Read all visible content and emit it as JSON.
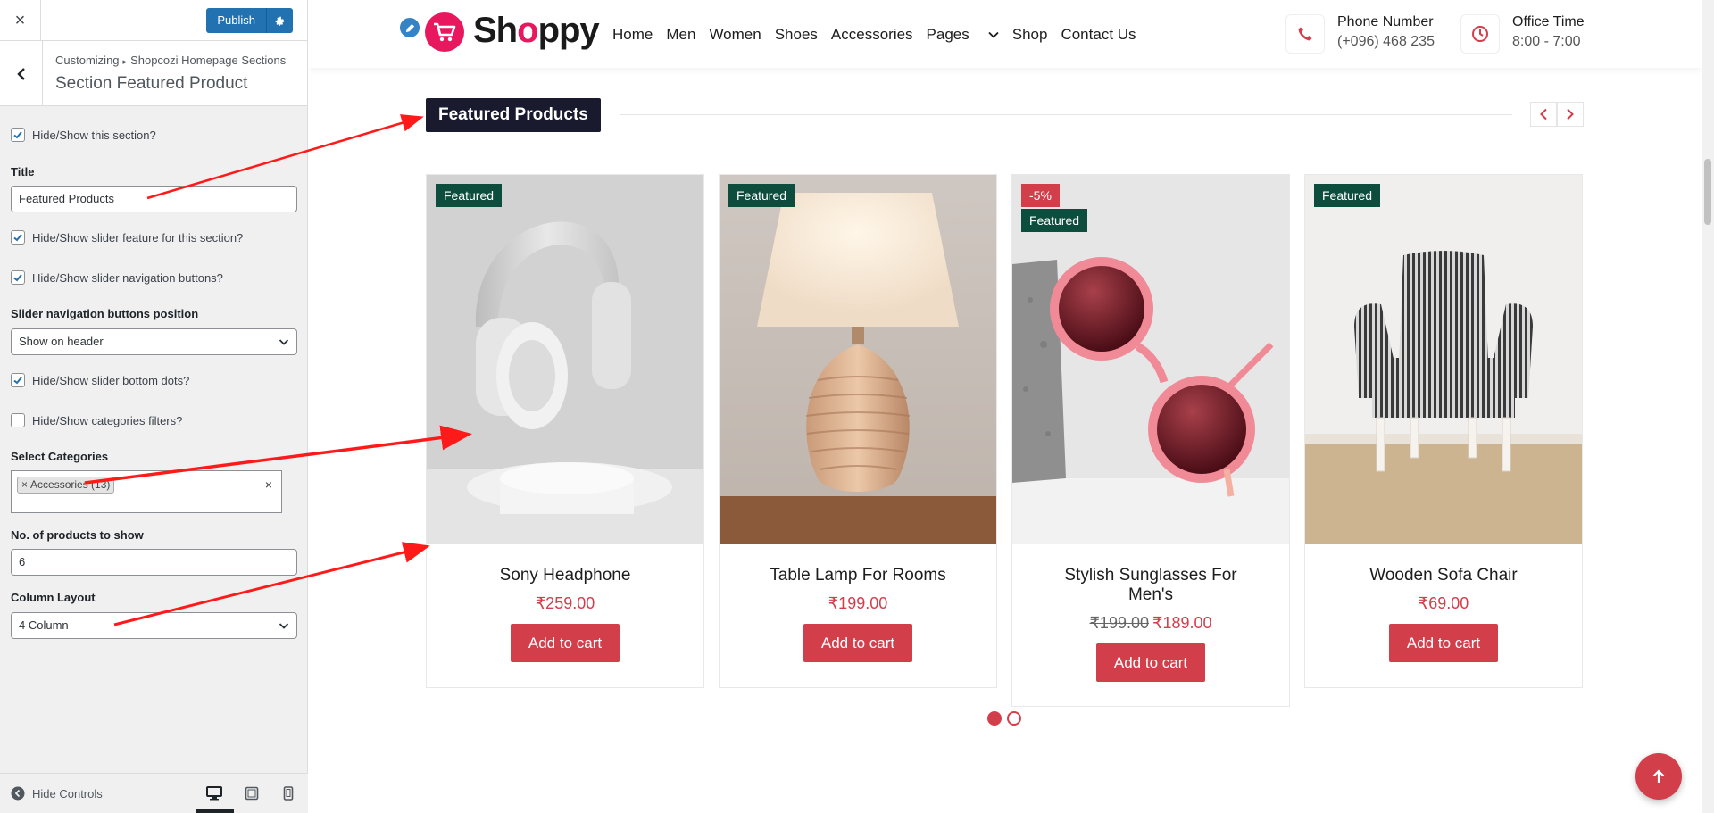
{
  "customizer": {
    "close_label": "×",
    "publish_label": "Publish",
    "breadcrumb": {
      "root": "Customizing",
      "sep": "▸",
      "parent": "Shopcozi Homepage Sections"
    },
    "section_title": "Section Featured Product",
    "controls": {
      "show_section": "Hide/Show this section?",
      "title_label": "Title",
      "title_value": "Featured Products",
      "slider_feature": "Hide/Show slider feature for this section?",
      "slider_nav": "Hide/Show slider navigation buttons?",
      "nav_position_label": "Slider navigation buttons position",
      "nav_position_value": "Show on header",
      "slider_dots": "Hide/Show slider bottom dots?",
      "cat_filters": "Hide/Show categories filters?",
      "select_categories_label": "Select Categories",
      "category_tag": "Accessories (13)",
      "category_tag_remove": "×",
      "category_clear": "×",
      "products_count_label": "No. of products to show",
      "products_count_value": "6",
      "column_layout_label": "Column Layout",
      "column_layout_value": "4 Column"
    },
    "footer": {
      "hide_controls": "Hide Controls"
    }
  },
  "site": {
    "logo_text": "Sh",
    "logo_o": "o",
    "logo_rest": "ppy",
    "nav": [
      "Home",
      "Men",
      "Women",
      "Shoes",
      "Accessories",
      "Pages",
      "Shop",
      "Contact Us"
    ],
    "phone": {
      "title": "Phone Number",
      "value": "(+096) 468 235"
    },
    "office": {
      "title": "Office Time",
      "value": "8:00 - 7:00"
    }
  },
  "section": {
    "heading": "Featured Products"
  },
  "products": [
    {
      "badge": "Featured",
      "name": "Sony Headphone",
      "price": "₹259.00",
      "button": "Add to cart"
    },
    {
      "badge": "Featured",
      "name": "Table Lamp For Rooms",
      "price": "₹199.00",
      "button": "Add to cart"
    },
    {
      "sale_badge": "-5%",
      "badge": "Featured",
      "name": "Stylish Sunglasses For Men's",
      "old_price": "₹199.00",
      "price": "₹189.00",
      "button": "Add to cart"
    },
    {
      "badge": "Featured",
      "name": "Wooden Sofa Chair",
      "price": "₹69.00",
      "button": "Add to cart"
    }
  ],
  "colors": {
    "accent": "#d33e4b",
    "badge": "#0d4d3d",
    "wp_blue": "#2271b1",
    "annotation_arrow": "#ff1a1a"
  }
}
